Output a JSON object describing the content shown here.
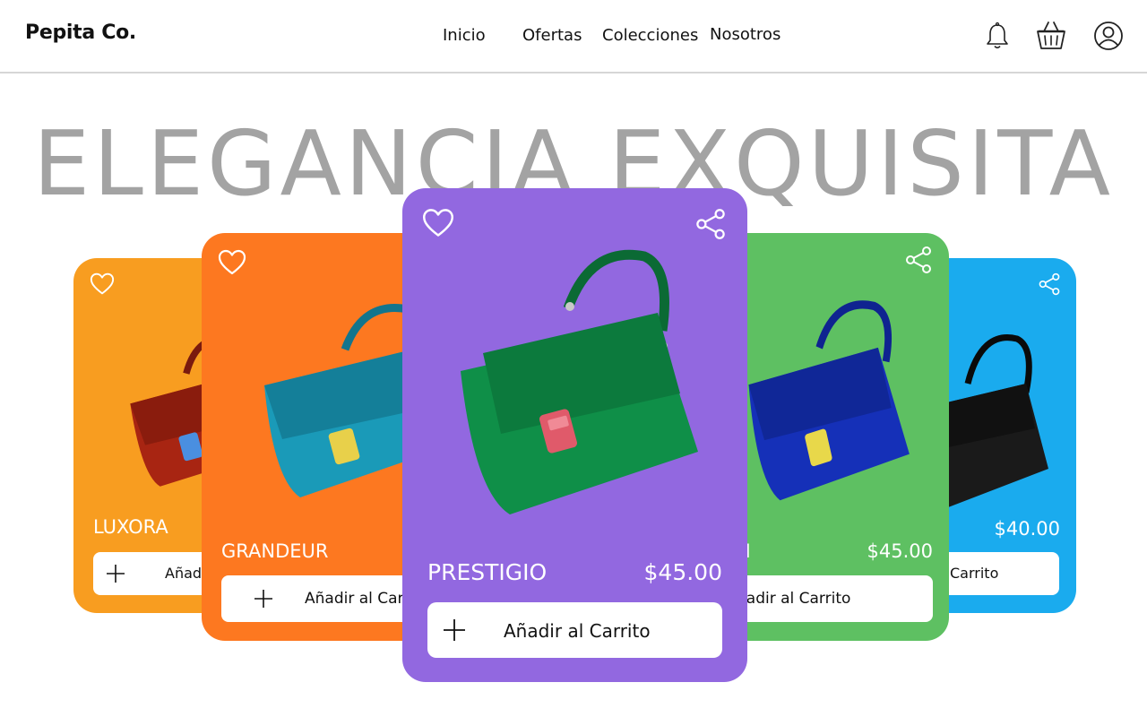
{
  "brand": {
    "name": "Pepita Co."
  },
  "nav": {
    "items": [
      "Inicio",
      "Ofertas",
      "Colecciones",
      "Nosotros"
    ]
  },
  "header_icons": [
    "bell-icon",
    "basket-icon",
    "user-icon"
  ],
  "hero": {
    "title": "ELEGANCIA EXQUISITA"
  },
  "cards": [
    {
      "name": "LUXORA",
      "price": "",
      "cart_label": "Añad",
      "bg_color": "#f89d20",
      "bag_color": "#a82512",
      "clasp_color": "#4a8fe0",
      "icons": [
        "heart-icon"
      ]
    },
    {
      "name": "GRANDEUR",
      "price": "",
      "cart_label": "Añadir al Carrito",
      "bg_color": "#fd7820",
      "bag_color": "#1a9ab8",
      "clasp_color": "#e8d04a",
      "icons": [
        "heart-icon"
      ]
    },
    {
      "name": "PRESTIGIO",
      "price": "$45.00",
      "cart_label": "Añadir al Carrito",
      "bg_color": "#9268e0",
      "bag_color": "#0f8f48",
      "clasp_color": "#e05a6a",
      "icons": [
        "heart-icon",
        "share-icon"
      ]
    },
    {
      "name": "N",
      "price": "$45.00",
      "cart_label": "ñadir al Carrito",
      "bg_color": "#5ec062",
      "bag_color": "#1530b8",
      "clasp_color": "#e8d84a",
      "icons": [
        "share-icon"
      ]
    },
    {
      "name": "",
      "price": "$40.00",
      "cart_label": "Carrito",
      "bg_color": "#1aabee",
      "bag_color": "#1a1a1a",
      "clasp_color": "#c0c0c0",
      "icons": [
        "share-icon"
      ]
    }
  ],
  "colors": {
    "hero_title": "#a3a3a3",
    "header_border": "#d6d6d6"
  }
}
